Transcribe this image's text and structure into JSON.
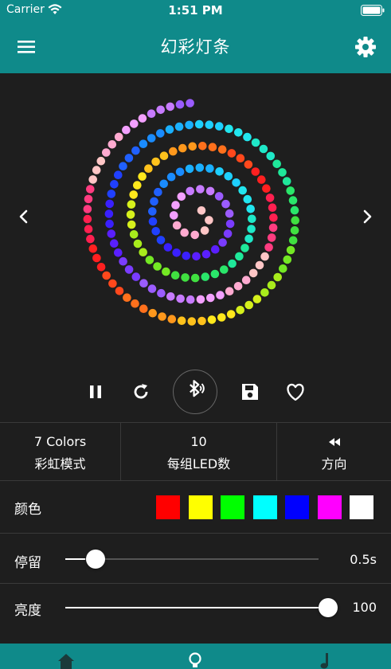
{
  "status_bar": {
    "carrier": "Carrier",
    "time": "1:51 PM"
  },
  "nav": {
    "title": "幻彩灯条",
    "menu_icon": "hamburger-menu-icon",
    "settings_icon": "gear-icon"
  },
  "preview": {
    "prev_icon": "chevron-left-icon",
    "next_icon": "chevron-right-icon",
    "spiral_colors": [
      "#ffc6c6",
      "#ffaad0",
      "#f3a0ff",
      "#c77bff",
      "#9b5cff",
      "#7a3cff",
      "#5a1fff",
      "#3a20ff",
      "#2040ff",
      "#2060ff",
      "#1a8cff",
      "#1ab0ff",
      "#1ed0ff",
      "#22e6ef",
      "#1fe8c8",
      "#1fe89a",
      "#2ae66a",
      "#40e040",
      "#74e824",
      "#a8ec1c",
      "#d6f01c",
      "#ffe81c",
      "#ffc21c",
      "#ff981c",
      "#ff701c",
      "#ff481c",
      "#ff2020",
      "#ff2050",
      "#ff3c80"
    ]
  },
  "controls": {
    "pause_icon": "pause-icon",
    "reload_icon": "reload-icon",
    "bluetooth_icon": "bluetooth-audio-icon",
    "save_icon": "floppy-save-icon",
    "favorite_icon": "heart-icon"
  },
  "modes": {
    "mode": {
      "top": "7 Colors",
      "bottom": "彩虹模式"
    },
    "led_count": {
      "top": "10",
      "bottom": "每组LED数"
    },
    "direction": {
      "icon": "rewind-icon",
      "bottom": "方向"
    }
  },
  "colors": {
    "label": "颜色",
    "swatches": [
      "#ff0000",
      "#ffff00",
      "#00ff00",
      "#00ffff",
      "#0000ff",
      "#ff00ff",
      "#ffffff"
    ]
  },
  "stay": {
    "label": "停留",
    "value": "0.5s",
    "level": 0.08
  },
  "brightness": {
    "label": "亮度",
    "value": "100",
    "level": 1.0
  },
  "accent_color": "#0f8a8a",
  "tabbar": {
    "icons": [
      "home-icon",
      "lightbulb-icon",
      "music-note-icon"
    ]
  }
}
